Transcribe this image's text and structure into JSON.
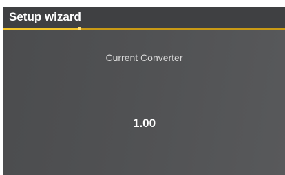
{
  "header": {
    "title": "Setup wizard"
  },
  "progress": {
    "fraction": 0.27
  },
  "field": {
    "label": "Current Converter",
    "value": "1.00"
  },
  "colors": {
    "accent": "#f2c42a",
    "background": "#505153",
    "header_background": "#3f4042",
    "text": "#ffffff"
  }
}
